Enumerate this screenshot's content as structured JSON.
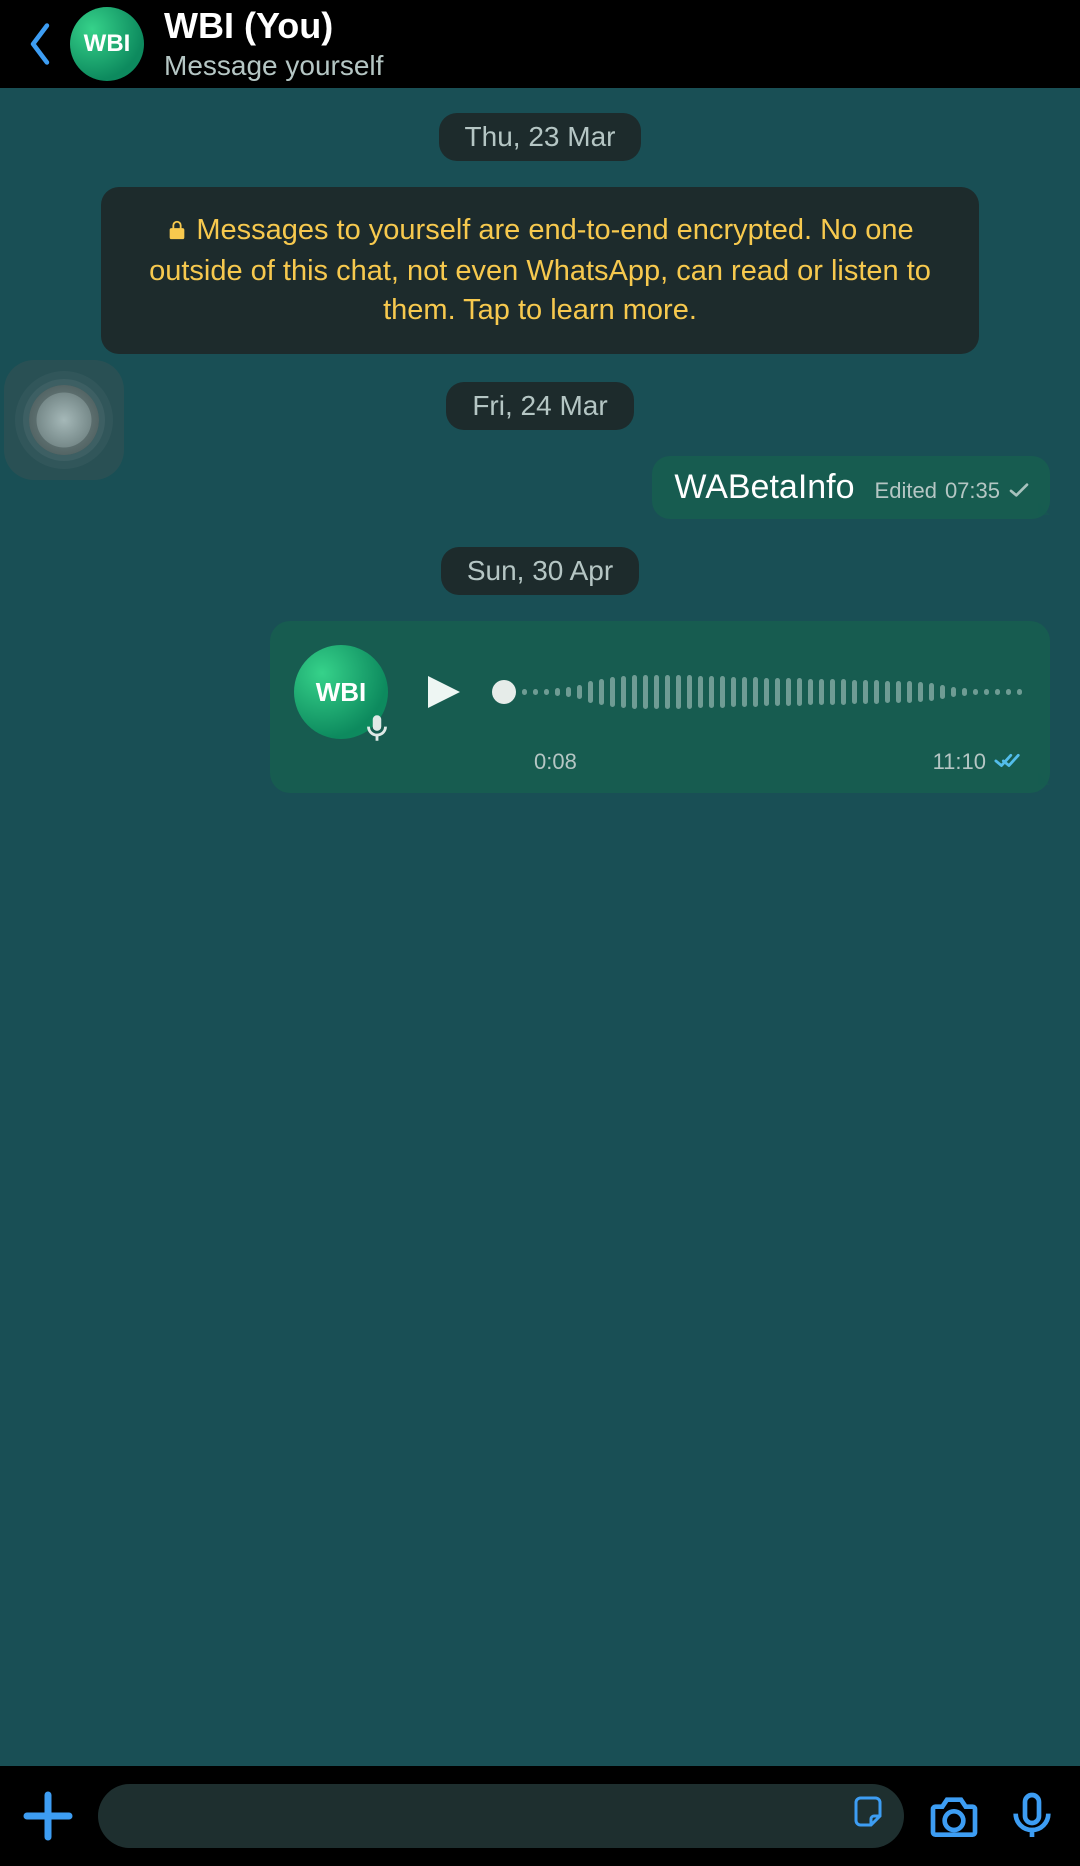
{
  "header": {
    "avatar_label": "WBI",
    "title": "WBI (You)",
    "subtitle": "Message yourself"
  },
  "chips": {
    "date1": "Thu, 23 Mar",
    "date2": "Fri, 24 Mar",
    "date3": "Sun, 30 Apr"
  },
  "system": {
    "text": "Messages to yourself are end-to-end encrypted. No one outside of this chat, not even WhatsApp, can read or listen to them. Tap to learn more."
  },
  "msg1": {
    "text": "WABetaInfo",
    "edited_label": "Edited",
    "time": "07:35",
    "status": "sent"
  },
  "voice": {
    "avatar_label": "WBI",
    "duration": "0:08",
    "time": "11:10",
    "status": "read"
  },
  "icons": {
    "back": "back-icon",
    "lock": "lock-icon",
    "plus": "plus-icon",
    "sticker": "sticker-icon",
    "camera": "camera-icon",
    "mic": "mic-icon",
    "mic_badge": "mic-badge-icon",
    "play": "play-icon",
    "assistive": "assistive-touch-icon"
  },
  "colors": {
    "accent_blue": "#3d9df3",
    "read_blue": "#53bdeb",
    "yellow": "#f7c94e",
    "bubble": "#175c50",
    "chat_bg": "#194f55"
  }
}
